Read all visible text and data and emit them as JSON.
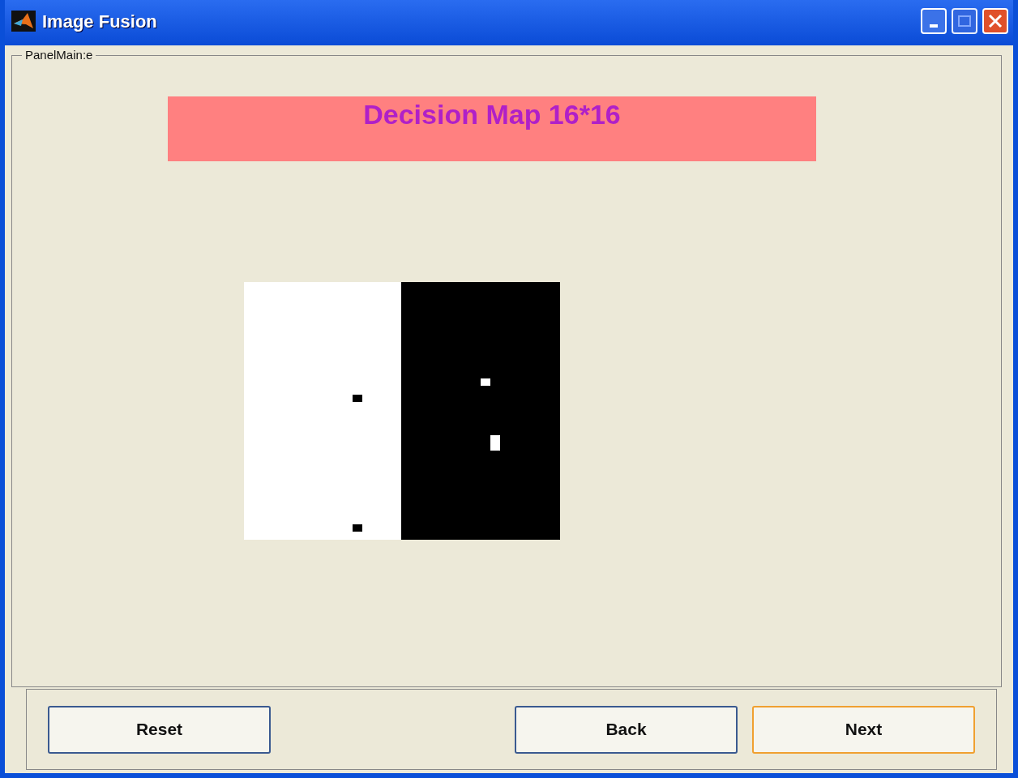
{
  "window": {
    "title": "Image Fusion"
  },
  "panel": {
    "legend": "PanelMain:e"
  },
  "banner": {
    "title": "Decision Map 16*16"
  },
  "buttons": [
    {
      "label": "Reset",
      "focused": false
    },
    {
      "label": "Back",
      "focused": false
    },
    {
      "label": "Next",
      "focused": true
    }
  ]
}
